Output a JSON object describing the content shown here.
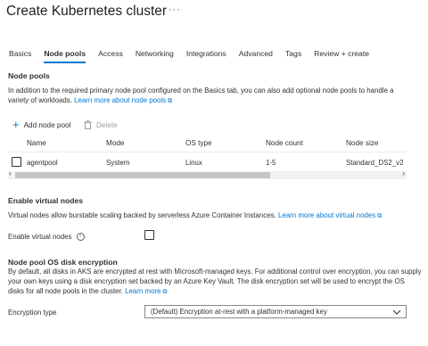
{
  "header": {
    "title": "Create Kubernetes cluster",
    "more": "···"
  },
  "tabs": [
    {
      "label": "Basics"
    },
    {
      "label": "Node pools"
    },
    {
      "label": "Access"
    },
    {
      "label": "Networking"
    },
    {
      "label": "Integrations"
    },
    {
      "label": "Advanced"
    },
    {
      "label": "Tags"
    },
    {
      "label": "Review + create"
    }
  ],
  "node_pools": {
    "heading": "Node pools",
    "description": "In addition to the required primary node pool configured on the Basics tab, you can also add optional node pools to handle a variety of workloads.",
    "learn_more": "Learn more about node pools",
    "add_label": "Add node pool",
    "delete_label": "Delete",
    "columns": [
      "Name",
      "Mode",
      "OS type",
      "Node count",
      "Node size"
    ],
    "rows": [
      {
        "name": "agentpool",
        "mode": "System",
        "os": "Linux",
        "count": "1-5",
        "size": "Standard_DS2_v2"
      }
    ]
  },
  "virtual_nodes": {
    "heading": "Enable virtual nodes",
    "description": "Virtual nodes allow burstable scaling backed by serverless Azure Container Instances.",
    "learn_more": "Learn more about virtual nodes",
    "field_label": "Enable virtual nodes",
    "checked": false
  },
  "encryption": {
    "heading": "Node pool OS disk encryption",
    "description": "By default, all disks in AKS are encrypted at rest with Microsoft-managed keys. For additional control over encryption, you can supply your own keys using a disk encryption set backed by an Azure Key Vault. The disk encryption set will be used to encrypt the OS disks for all node pools in the cluster.",
    "learn_more": "Learn more",
    "field_label": "Encryption type",
    "selected": "(Default) Encryption at-rest with a platform-managed key"
  },
  "colors": {
    "accent": "#0078d4",
    "text": "#323130",
    "disabled": "#a19f9d"
  }
}
